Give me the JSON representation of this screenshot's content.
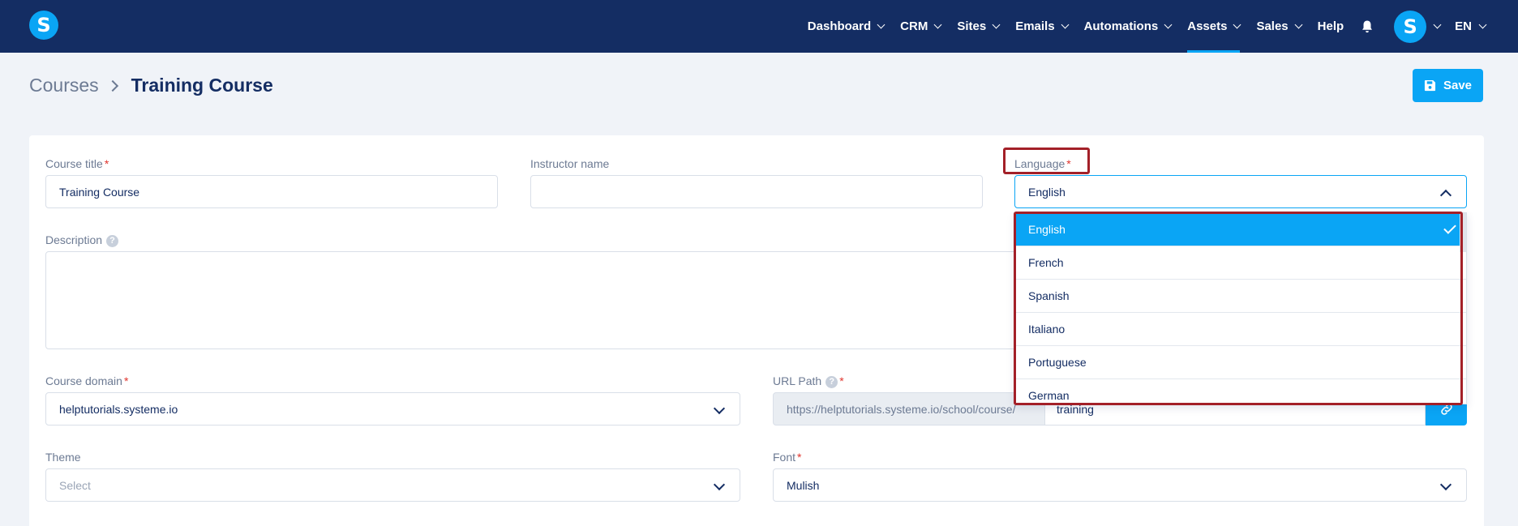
{
  "app": {
    "logo_letter": "S",
    "nav": [
      {
        "label": "Dashboard",
        "active": false
      },
      {
        "label": "CRM",
        "active": false
      },
      {
        "label": "Sites",
        "active": false
      },
      {
        "label": "Emails",
        "active": false
      },
      {
        "label": "Automations",
        "active": false
      },
      {
        "label": "Assets",
        "active": true
      },
      {
        "label": "Sales",
        "active": false
      }
    ],
    "help": "Help",
    "avatar_letter": "S",
    "language": "EN"
  },
  "breadcrumb": {
    "parent": "Courses",
    "current": "Training Course"
  },
  "save_label": "Save",
  "form": {
    "course_title": {
      "label": "Course title",
      "required": "*",
      "value": "Training Course"
    },
    "instructor_name": {
      "label": "Instructor name",
      "value": ""
    },
    "language": {
      "label": "Language",
      "required": "*",
      "value": "English"
    },
    "description": {
      "label": "Description",
      "help": "?"
    },
    "course_domain": {
      "label": "Course domain",
      "required": "*",
      "value": "helptutorials.systeme.io"
    },
    "url_path": {
      "label": "URL Path",
      "help": "?",
      "required": "*",
      "prefix": "https://helptutorials.systeme.io/school/course/",
      "value": "training"
    },
    "theme": {
      "label": "Theme",
      "placeholder": "Select"
    },
    "font": {
      "label": "Font",
      "required": "*",
      "value": "Mulish"
    }
  },
  "language_options": [
    "English",
    "French",
    "Spanish",
    "Italiano",
    "Portuguese",
    "German"
  ],
  "colors": {
    "navy": "#142d63",
    "accent": "#0aa5f5",
    "highlight": "#a32028",
    "required": "#e0342d"
  }
}
